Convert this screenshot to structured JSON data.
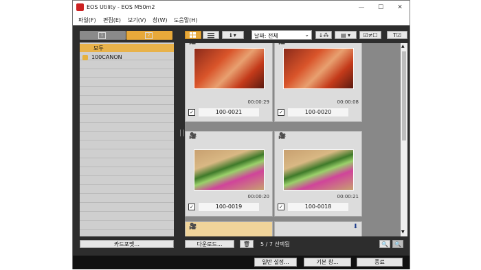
{
  "window": {
    "title": "EOS Utility -  EOS M50m2",
    "controls": {
      "minimize": "—",
      "maximize": "☐",
      "close": "✕"
    }
  },
  "menu": [
    "파일(F)",
    "편집(E)",
    "보기(V)",
    "창(W)",
    "도움말(H)"
  ],
  "left_panel": {
    "tab1_label": "1",
    "tab2_label": "2",
    "folders": [
      {
        "label": "모두",
        "selected": true
      },
      {
        "label": "100CANON",
        "selected": false
      }
    ],
    "card_format_button": "카드포맷..."
  },
  "toolbar": {
    "grid_icon": "grid-icon",
    "list_icon": "list-icon",
    "info_label": "ℹ ▾",
    "date_filter_value": "날짜: 전체",
    "sort_label": "↓⁂",
    "group_label": "▤ ▾",
    "check_label": "☑≠☐",
    "filter_label": "T☑"
  },
  "thumbnails": [
    {
      "name": "100-0021",
      "duration": "00:00:29",
      "checked": true,
      "thumb_color": "orange"
    },
    {
      "name": "100-0020",
      "duration": "00:00:08",
      "checked": true,
      "thumb_color": "orange"
    },
    {
      "name": "100-0019",
      "duration": "00:00:20",
      "checked": true,
      "thumb_color": "green"
    },
    {
      "name": "100-0018",
      "duration": "00:00:21",
      "checked": true,
      "thumb_color": "green"
    }
  ],
  "footer": {
    "download_button": "다운로드...",
    "trash_icon": "🗑",
    "selection_count": "5 / 7 선택됨",
    "zoom_out": "🔍",
    "zoom_in": "🔍"
  },
  "bottom_buttons": {
    "preferences": "일반 설정...",
    "main_window": "기본 창...",
    "quit": "종료"
  },
  "colors": {
    "accent": "#e8a93a",
    "selected_folder": "#e8b24a",
    "video_icon": "#1a3a8a"
  }
}
